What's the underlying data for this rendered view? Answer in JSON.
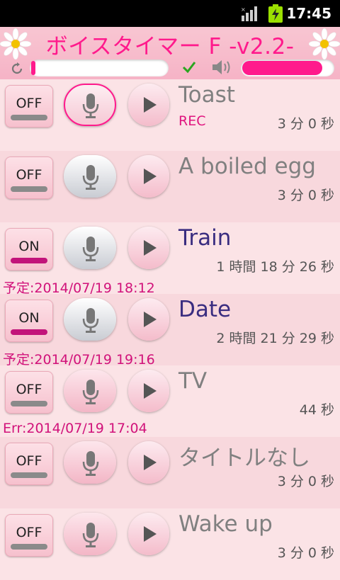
{
  "status_bar": {
    "time": "17:45"
  },
  "header": {
    "title": "ボイスタイマー F -v2.2-",
    "left_progress": 0.03,
    "volume_level": 0.88,
    "accent_color": "#ff1a8c"
  },
  "timers": [
    {
      "toggle": "OFF",
      "title": "Toast",
      "status": "REC",
      "duration": "3 分 0 秒",
      "note": "",
      "mic": "recording",
      "active": false
    },
    {
      "toggle": "OFF",
      "title": "A boiled egg",
      "status": "",
      "duration": "3 分 0 秒",
      "note": "",
      "mic": "gray",
      "active": false
    },
    {
      "toggle": "ON",
      "title": "Train",
      "status": "",
      "duration": "1 時間 18 分 26 秒",
      "note": "予定:2014/07/19 18:12",
      "mic": "gray",
      "active": true
    },
    {
      "toggle": "ON",
      "title": "Date",
      "status": "",
      "duration": "2 時間 21 分 29 秒",
      "note": "予定:2014/07/19 19:16",
      "mic": "gray",
      "active": true
    },
    {
      "toggle": "OFF",
      "title": "TV",
      "status": "",
      "duration": "44 秒",
      "note": "Err:2014/07/19 17:04",
      "mic": "pink",
      "active": false
    },
    {
      "toggle": "OFF",
      "title": "タイトルなし",
      "status": "",
      "duration": "3 分 0 秒",
      "note": "",
      "mic": "pink",
      "active": false
    },
    {
      "toggle": "OFF",
      "title": "Wake up",
      "status": "",
      "duration": "3 分 0 秒",
      "note": "",
      "mic": "pink",
      "active": false
    }
  ]
}
